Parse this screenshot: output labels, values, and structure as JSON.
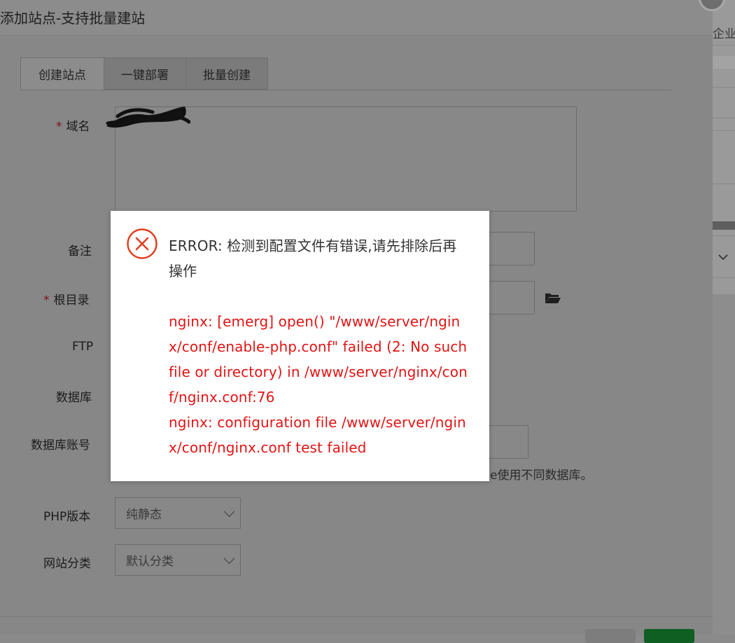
{
  "dialog": {
    "title": "添加站点-支持批量建站",
    "tabs": [
      {
        "label": "创建站点",
        "active": true
      },
      {
        "label": "一键部署",
        "active": false
      },
      {
        "label": "批量创建",
        "active": false
      }
    ]
  },
  "form": {
    "domain_label": "域名",
    "remark_label": "备注",
    "root_label": "根目录",
    "ftp_label": "FTP",
    "database_label": "数据库",
    "db_account_label": "数据库账号",
    "db_hint_partial": "e使用不同数据库。",
    "php_label": "PHP版本",
    "php_value": "纯静态",
    "category_label": "网站分类",
    "category_value": "默认分类",
    "required_mark": "*"
  },
  "background": {
    "edition_partial": "企业版"
  },
  "error": {
    "heading": "ERROR: 检测到配置文件有错误,请先排除后再操作",
    "lines": [
      "nginx: [emerg] open() \"/www/server/nginx/conf/enable-php.conf\" failed (2: No such file or directory) in /www/server/nginx/conf/nginx.conf:76",
      "nginx: configuration file /www/server/nginx/conf/nginx.conf test failed"
    ]
  },
  "colors": {
    "error_red": "#e01515",
    "overlay_grey": "#878787",
    "submit_green": "#0f5e22"
  }
}
